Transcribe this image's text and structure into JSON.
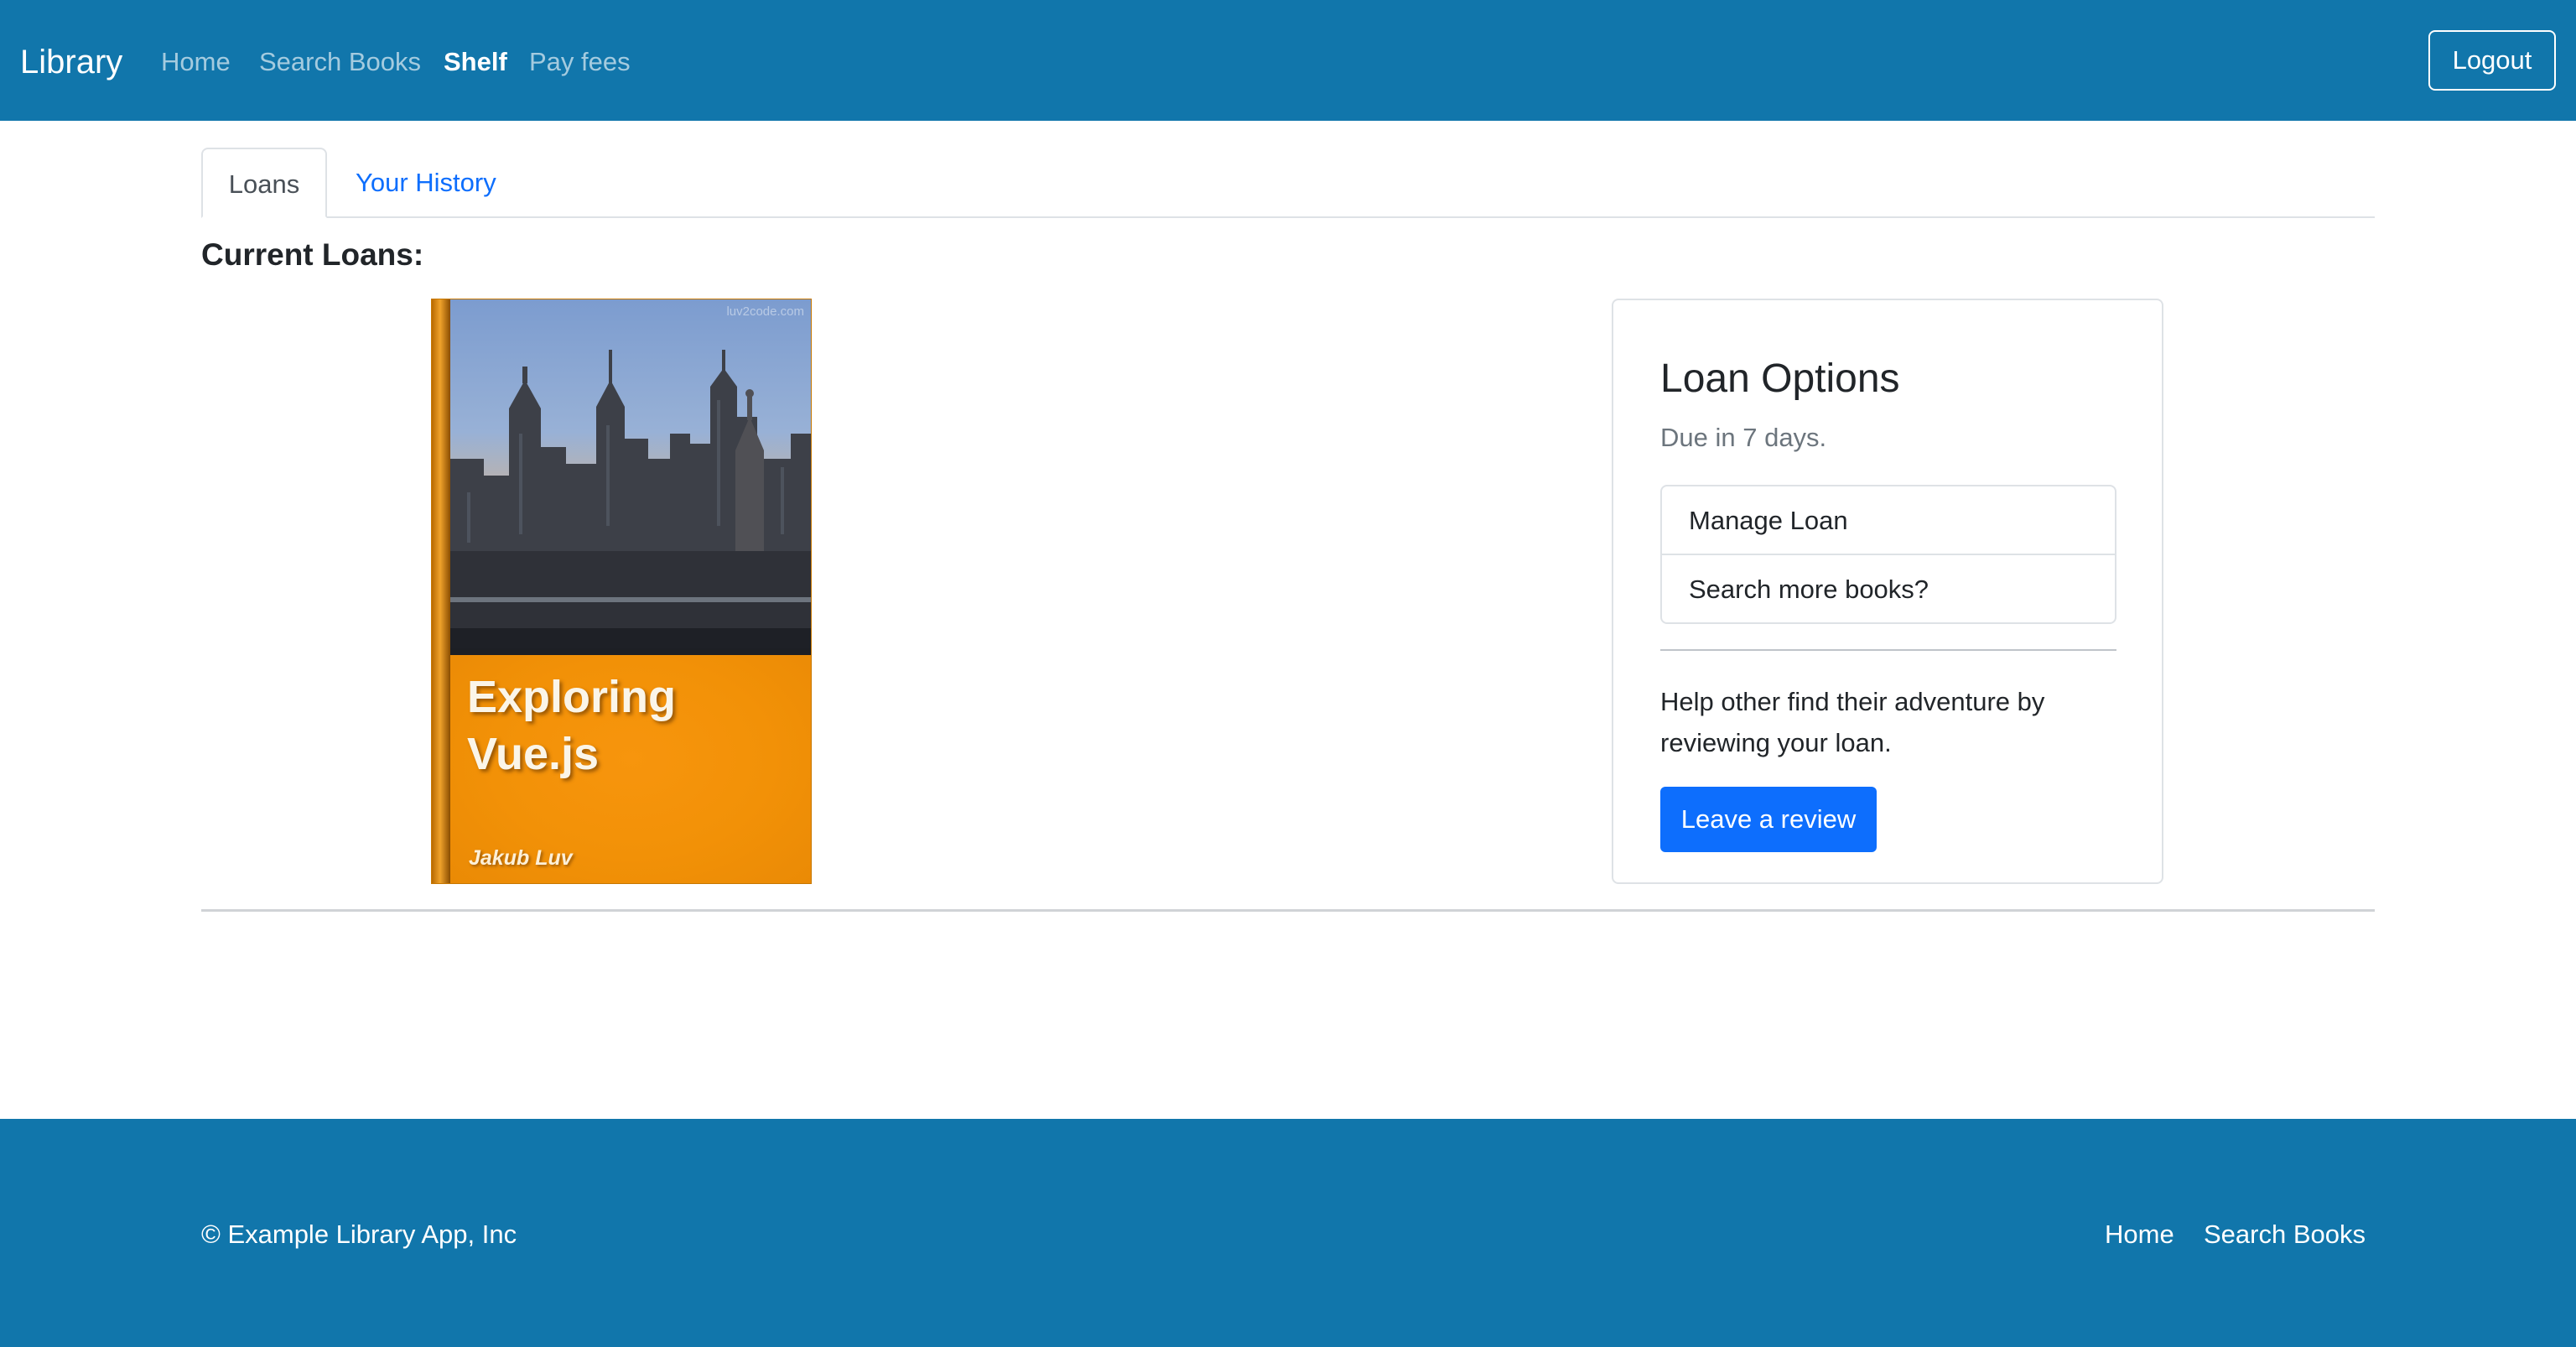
{
  "navbar": {
    "brand": "Library",
    "links": [
      "Home",
      "Search Books",
      "Shelf",
      "Pay fees"
    ],
    "active_link": "Shelf",
    "logout_label": "Logout"
  },
  "tabs": [
    {
      "label": "Loans",
      "active": true
    },
    {
      "label": "Your History",
      "active": false
    }
  ],
  "section_title": "Current Loans:",
  "book": {
    "title": "Exploring\nVue.js",
    "author": "Jakub Luv",
    "watermark": "luv2code.com"
  },
  "loan_options": {
    "title": "Loan Options",
    "due_text": "Due in 7 days.",
    "items": [
      "Manage Loan",
      "Search more books?"
    ],
    "help_text": "Help other find their adventure by reviewing your loan.",
    "review_button": "Leave a review"
  },
  "footer": {
    "copyright": "© Example Library App, Inc",
    "links": [
      "Home",
      "Search Books"
    ]
  },
  "colors": {
    "navbar_bg": "#1176ab",
    "primary": "#0d6efd",
    "book_orange": "#f29107"
  }
}
